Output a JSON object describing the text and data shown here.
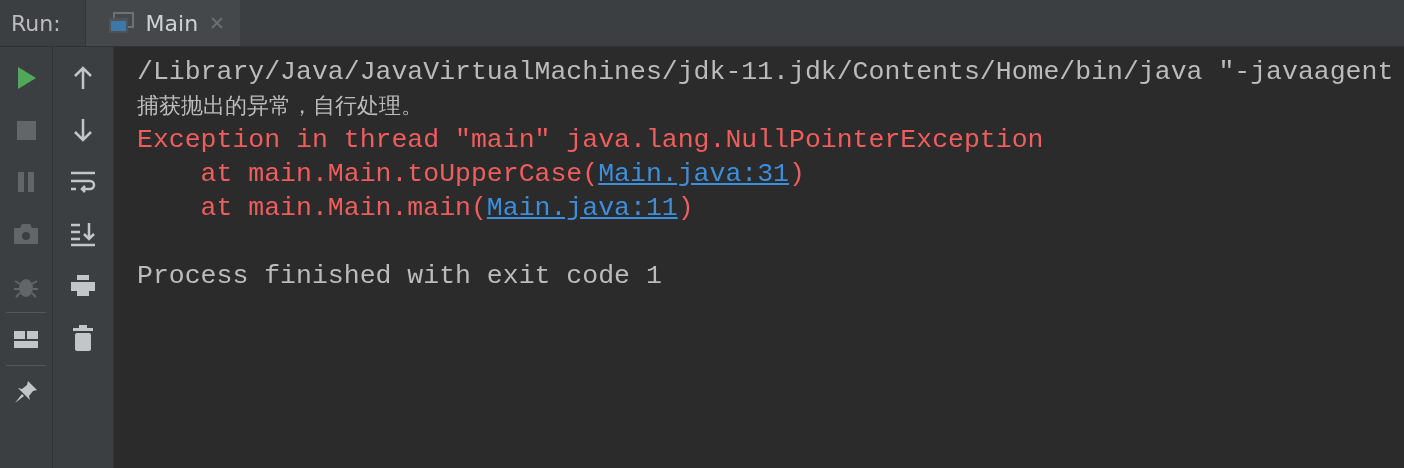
{
  "run_panel": {
    "label": "Run:",
    "tabs": [
      {
        "label": "Main",
        "selected": true
      }
    ]
  },
  "left_toolbar": [
    {
      "kind": "run",
      "disabled": false
    },
    {
      "kind": "stop",
      "disabled": true
    },
    {
      "kind": "pause",
      "disabled": true
    },
    {
      "kind": "camera",
      "disabled": true
    },
    {
      "kind": "bug",
      "disabled": true
    },
    {
      "kind": "separator"
    },
    {
      "kind": "layout",
      "disabled": false
    },
    {
      "kind": "separator"
    },
    {
      "kind": "pin",
      "disabled": false
    }
  ],
  "console_toolbar": [
    {
      "kind": "up"
    },
    {
      "kind": "down"
    },
    {
      "kind": "wrap"
    },
    {
      "kind": "scroll-end"
    },
    {
      "kind": "print"
    },
    {
      "kind": "trash"
    }
  ],
  "console": [
    {
      "kind": "system",
      "segments": [
        {
          "kind": "text",
          "text": "/Library/Java/JavaVirtualMachines/jdk-11.jdk/Contents/Home/bin/java \"-javaagent"
        }
      ]
    },
    {
      "kind": "stdout",
      "segments": [
        {
          "kind": "text",
          "text": "捕获抛出的异常，自行处理。"
        }
      ]
    },
    {
      "kind": "stderr",
      "segments": [
        {
          "kind": "text",
          "text": "Exception in thread \"main\" java.lang.NullPointerException"
        }
      ]
    },
    {
      "kind": "stderr",
      "segments": [
        {
          "kind": "text",
          "text": "    at main.Main.toUpperCase("
        },
        {
          "kind": "link",
          "text": "Main.java:31"
        },
        {
          "kind": "text",
          "text": ")"
        }
      ]
    },
    {
      "kind": "stderr",
      "segments": [
        {
          "kind": "text",
          "text": "    at main.Main.main("
        },
        {
          "kind": "link",
          "text": "Main.java:11"
        },
        {
          "kind": "text",
          "text": ")"
        }
      ]
    },
    {
      "kind": "blank"
    },
    {
      "kind": "system",
      "segments": [
        {
          "kind": "text",
          "text": "Process finished with exit code 1"
        }
      ]
    }
  ]
}
